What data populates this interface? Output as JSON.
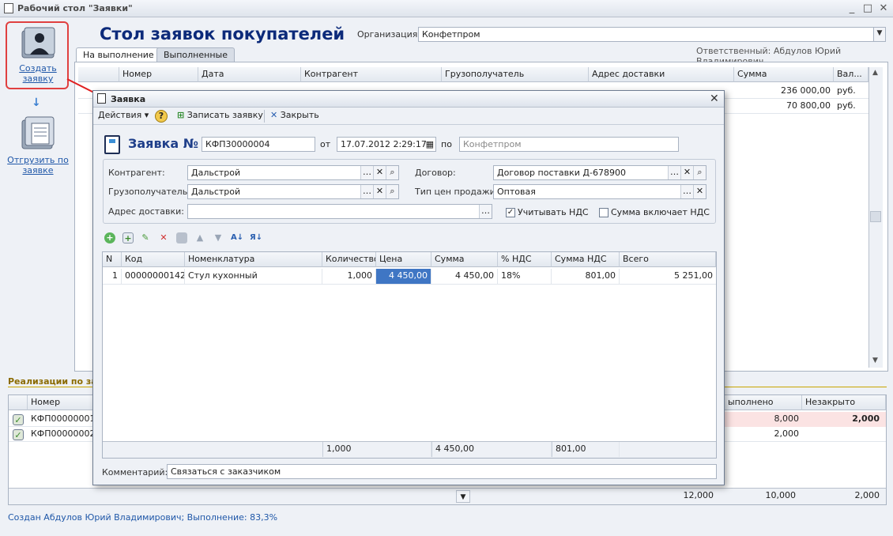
{
  "window": {
    "title": "Рабочий стол \"Заявки\"",
    "controls": [
      "_",
      "□",
      "✕"
    ]
  },
  "left_panel": {
    "create_label": "Создать заявку",
    "ship_label": "Отгрузить по заявке",
    "arrow": "↓"
  },
  "header": {
    "title": "Стол заявок покупателей",
    "org_label": "Организация:",
    "org_value": "Конфетпром",
    "responsible": "Ответственный: Абдулов Юрий Владимирович"
  },
  "tabs": [
    {
      "label": "На выполнение"
    },
    {
      "label": "Выполненные"
    }
  ],
  "main_table": {
    "columns": [
      "Номер",
      "Дата",
      "Контрагент",
      "Грузополучатель",
      "Адрес доставки",
      "Сумма",
      "Вал..."
    ],
    "rows": [
      {
        "sum": "236 000,00",
        "currency": "руб."
      },
      {
        "sum": "70 800,00",
        "currency": "руб."
      }
    ]
  },
  "bottom": {
    "title": "Реализации по за",
    "columns": [
      "Номер",
      "ыполнено",
      "Незакрыто"
    ],
    "rows": [
      {
        "number": "КФП00000001",
        "done": "8,000",
        "open": "2,000"
      },
      {
        "number": "КФП00000002",
        "done": "2,000",
        "open": ""
      }
    ],
    "totals": [
      "12,000",
      "10,000",
      "2,000"
    ]
  },
  "status": "Создан Абдулов Юрий Владимирович; Выполнение: 83,3%",
  "dialog": {
    "title": "Заявка",
    "toolbar": {
      "actions": "Действия",
      "help": "?",
      "save": "Записать заявку",
      "close": "Закрыть"
    },
    "heading": "Заявка №",
    "number": "КФП30000004",
    "from_label": "от",
    "date": "17.07.2012  2:29:17",
    "by_label": "по",
    "org": "Конфетпром",
    "form": {
      "contractor_label": "Контрагент:",
      "contractor": "Дальстрой",
      "consignee_label": "Грузополучатель:",
      "consignee": "Дальстрой",
      "address_label": "Адрес доставки:",
      "address": "",
      "contract_label": "Договор:",
      "contract": "Договор поставки Д-678900",
      "price_type_label": "Тип цен продажи:",
      "price_type": "Оптовая",
      "vat_label": "Учитывать НДС",
      "vat_checked": true,
      "sum_incl_vat_label": "Сумма включает НДС",
      "sum_incl_vat_checked": false
    },
    "items": {
      "columns": [
        "N",
        "Код",
        "Номенклатура",
        "Количество",
        "Цена",
        "Сумма",
        "% НДС",
        "Сумма НДС",
        "Всего"
      ],
      "rows": [
        {
          "n": "1",
          "code": "00000000142",
          "name": "Стул кухонный",
          "qty": "1,000",
          "price": "4 450,00",
          "sum": "4 450,00",
          "vat_pct": "18%",
          "vat_sum": "801,00",
          "total": "5 251,00"
        }
      ],
      "totals": {
        "qty": "1,000",
        "sum": "4 450,00",
        "vat_sum": "801,00"
      }
    },
    "comment_label": "Комментарий:",
    "comment": "Связаться с заказчиком"
  },
  "colors": {
    "title_blue": "#0c2a7a",
    "link_blue": "#1f57a8",
    "highlight_cell": "#3f76c4",
    "arrow_red": "#e02020"
  }
}
